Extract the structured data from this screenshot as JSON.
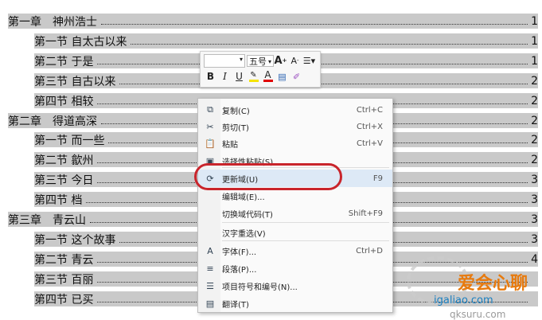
{
  "toc": [
    {
      "label": "第一章　神州浩士",
      "page": "1",
      "kind": "ch"
    },
    {
      "label": "第一节 自太古以来",
      "page": "1",
      "kind": "sec"
    },
    {
      "label": "第二节 于是",
      "page": "1",
      "kind": "sec"
    },
    {
      "label": "第三节 自古以来",
      "page": "2",
      "kind": "sec"
    },
    {
      "label": "第四节 相较",
      "page": "2",
      "kind": "sec"
    },
    {
      "label": "第二章　得道高深",
      "page": "2",
      "kind": "ch"
    },
    {
      "label": "第一节 而一些",
      "page": "2",
      "kind": "sec"
    },
    {
      "label": "第二节 歙州",
      "page": "2",
      "kind": "sec"
    },
    {
      "label": "第三节 今日",
      "page": "3",
      "kind": "sec"
    },
    {
      "label": "第四节 档",
      "page": "3",
      "kind": "sec"
    },
    {
      "label": "第三章　青云山",
      "page": "3",
      "kind": "ch"
    },
    {
      "label": "第一节 这个故事",
      "page": "3",
      "kind": "sec"
    },
    {
      "label": "第二节 青云",
      "page": "4",
      "kind": "sec"
    },
    {
      "label": "第三节 百丽",
      "page": "",
      "kind": "sec"
    },
    {
      "label": "第四节 已买",
      "page": "",
      "kind": "sec"
    }
  ],
  "mini_toolbar": {
    "font_name": "",
    "font_size": "五号",
    "grow_font": "A",
    "shrink_font": "A",
    "bold": "B",
    "italic": "I",
    "underline": "U",
    "font_color": "A"
  },
  "context_menu": {
    "items": [
      {
        "label": "复制(C)",
        "shortcut": "Ctrl+C",
        "icon": "copy-icon"
      },
      {
        "label": "剪切(T)",
        "shortcut": "Ctrl+X",
        "icon": "scissors-icon"
      },
      {
        "label": "粘贴",
        "shortcut": "Ctrl+V",
        "icon": "paste-icon"
      },
      {
        "label": "选择性粘贴(S)...",
        "shortcut": "",
        "icon": "paste-special-icon"
      },
      {
        "label": "更新域(U)",
        "shortcut": "F9",
        "icon": "update-field-icon"
      },
      {
        "label": "编辑域(E)...",
        "shortcut": "",
        "icon": ""
      },
      {
        "label": "切换域代码(T)",
        "shortcut": "Shift+F9",
        "icon": ""
      },
      {
        "label": "汉字重选(V)",
        "shortcut": "",
        "icon": ""
      },
      {
        "label": "字体(F)...",
        "shortcut": "Ctrl+D",
        "icon": "font-icon"
      },
      {
        "label": "段落(P)...",
        "shortcut": "",
        "icon": "paragraph-icon"
      },
      {
        "label": "项目符号和编号(N)...",
        "shortcut": "",
        "icon": "bullets-icon"
      },
      {
        "label": "翻译(T)",
        "shortcut": "",
        "icon": "translate-icon"
      }
    ],
    "highlighted": "更新域(U)"
  },
  "watermark": {
    "line1": "爱会心聊",
    "line2": "igaliao.com",
    "line3": "qksuru.com"
  },
  "colors": {
    "selection": "#c9c9c9",
    "highlight_oval": "#c9252c",
    "menu_hover": "#dde9f6"
  }
}
